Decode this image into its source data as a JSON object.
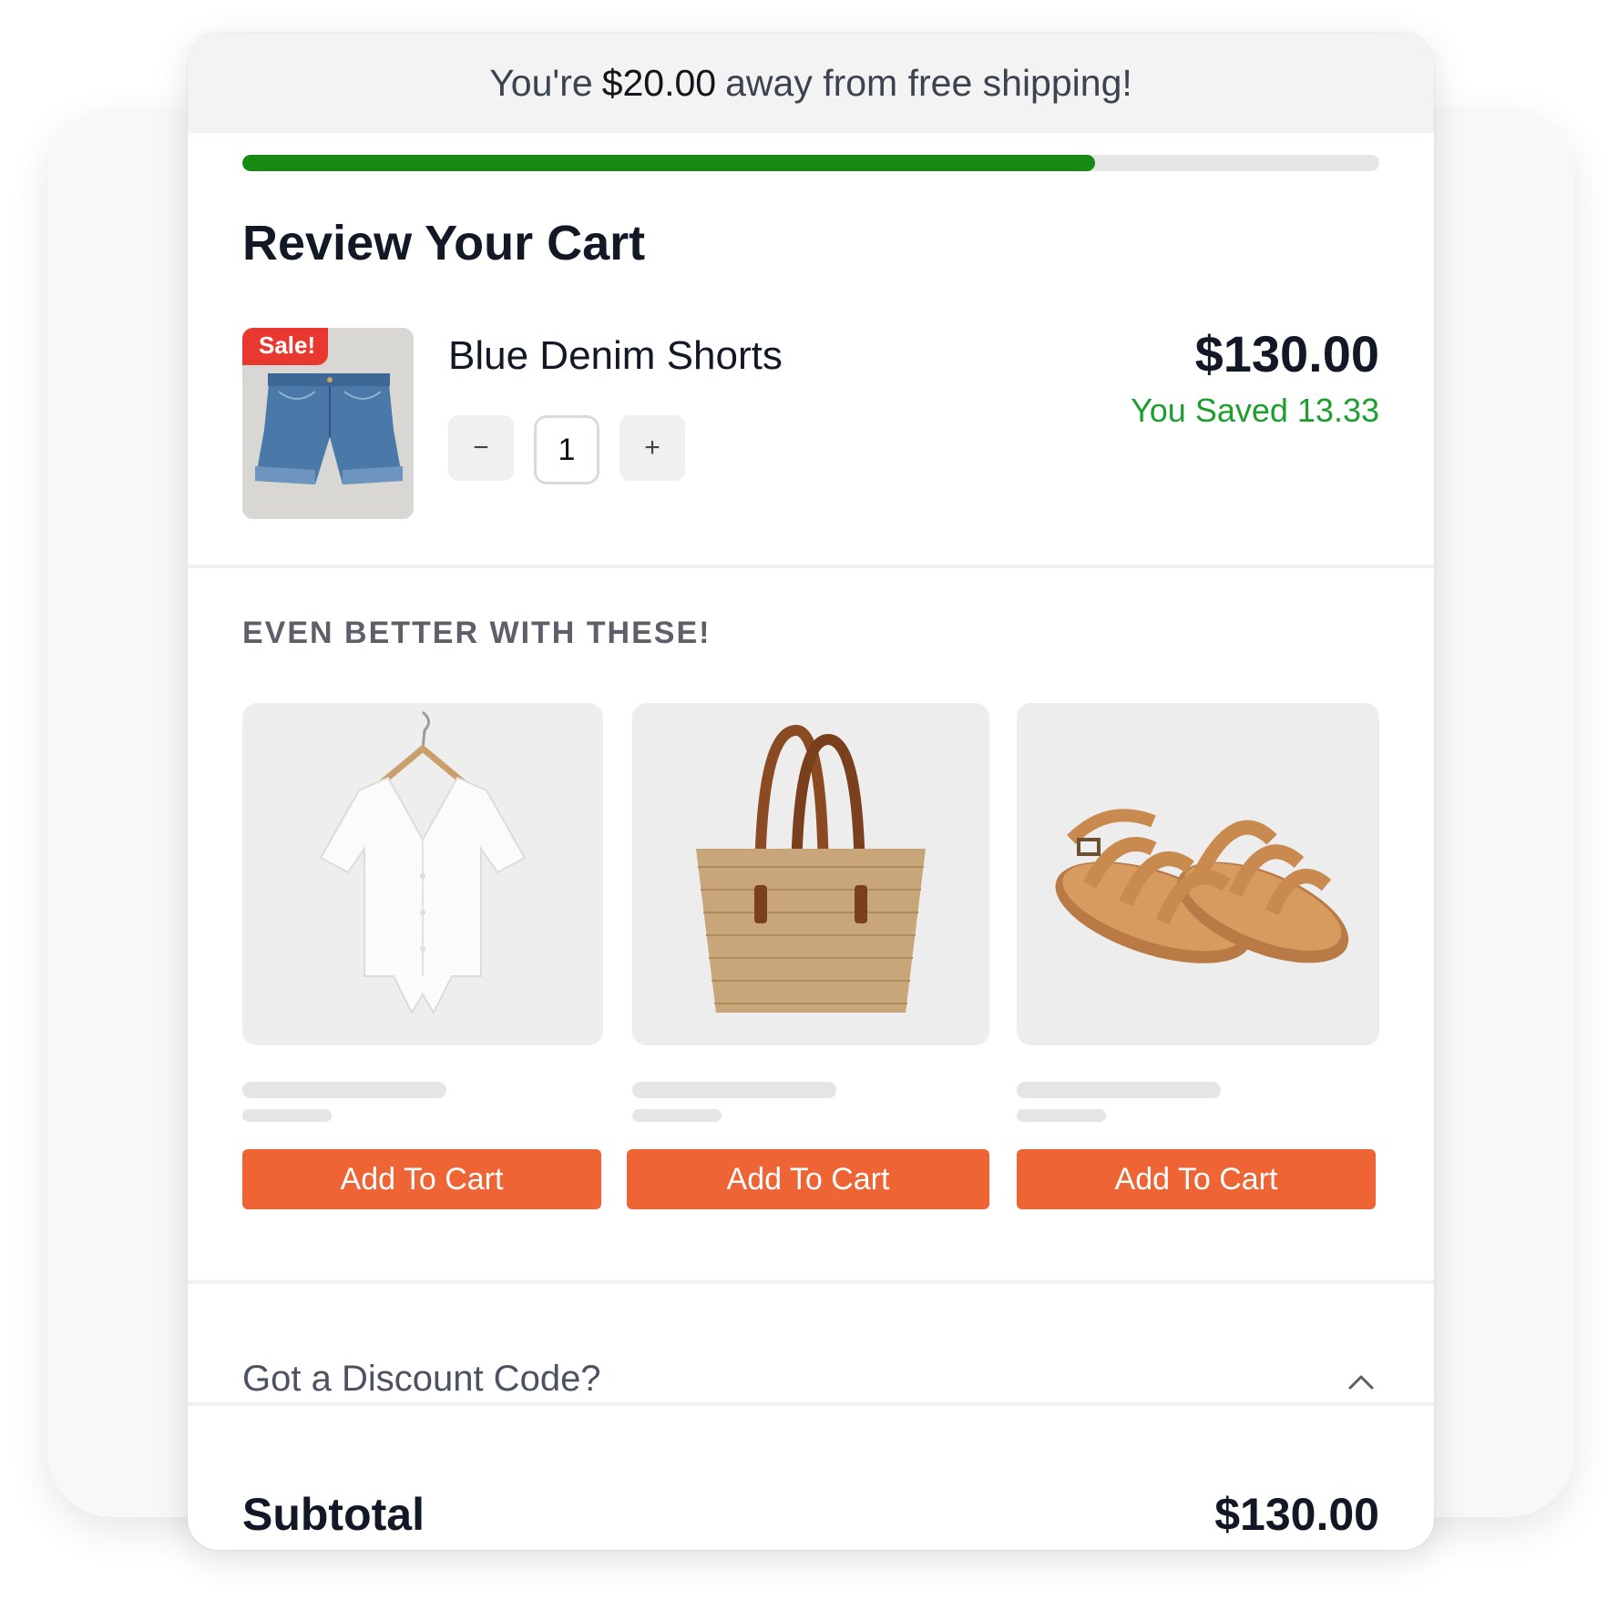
{
  "shipping_banner": {
    "prefix": "You're",
    "amount": "$20.00",
    "suffix": "away from free shipping!",
    "progress": 0.75
  },
  "cart": {
    "title": "Review Your Cart",
    "item": {
      "badge": "Sale!",
      "name": "Blue Denim Shorts",
      "quantity": "1",
      "decrement_label": "−",
      "increment_label": "+",
      "price": "$130.00",
      "saved": "You Saved 13.33",
      "image": "denim-shorts-image"
    }
  },
  "upsell": {
    "heading": "EVEN BETTER WITH THESE!",
    "products": [
      {
        "image": "white-tie-front-blouse-image",
        "button": "Add To Cart"
      },
      {
        "image": "straw-tote-bag-image",
        "button": "Add To Cart"
      },
      {
        "image": "tan-leather-sandals-image",
        "button": "Add To Cart"
      }
    ]
  },
  "discount": {
    "label": "Got a Discount Code?",
    "icon": "chevron-up-icon"
  },
  "summary": {
    "subtotal_label": "Subtotal",
    "subtotal_value": "$130.00"
  },
  "colors": {
    "accent_button": "#ee6434",
    "progress_fill": "#168a12",
    "saved_text": "#1e9e2f",
    "sale_badge": "#e8382f"
  }
}
